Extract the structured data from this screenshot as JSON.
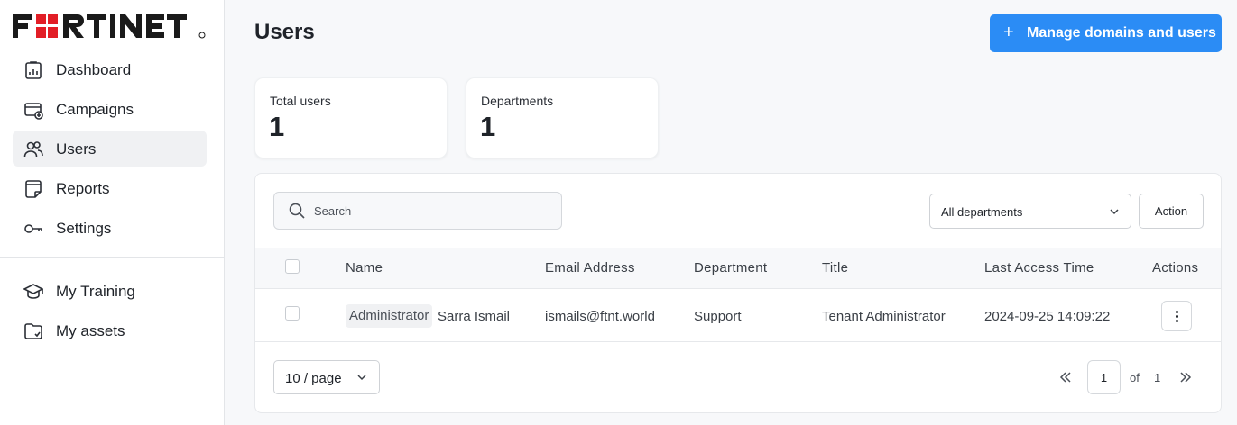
{
  "brand": {
    "name": "FORTINET",
    "accent": "#e21e26"
  },
  "sidebar": {
    "items": [
      {
        "label": "Dashboard",
        "icon": "dashboard-icon",
        "active": false
      },
      {
        "label": "Campaigns",
        "icon": "campaigns-icon",
        "active": false
      },
      {
        "label": "Users",
        "icon": "users-icon",
        "active": true
      },
      {
        "label": "Reports",
        "icon": "reports-icon",
        "active": false
      },
      {
        "label": "Settings",
        "icon": "key-icon",
        "active": false
      }
    ],
    "secondary_items": [
      {
        "label": "My Training",
        "icon": "graduation-cap-icon"
      },
      {
        "label": "My assets",
        "icon": "folder-icon"
      }
    ]
  },
  "header": {
    "title": "Users",
    "primary_button": {
      "icon": "plus-icon",
      "label": "Manage domains and users",
      "color": "#2b8cf5"
    }
  },
  "stats": [
    {
      "label": "Total users",
      "value": "1"
    },
    {
      "label": "Departments",
      "value": "1"
    }
  ],
  "toolbar": {
    "search_placeholder": "Search",
    "search_value": "",
    "department_select": "All departments",
    "action_label": "Action"
  },
  "table": {
    "columns": [
      "Name",
      "Email Address",
      "Department",
      "Title",
      "Last Access Time",
      "Actions"
    ],
    "rows": [
      {
        "role_tag": "Administrator",
        "name": "Sarra Ismail",
        "email": "ismails@ftnt.world",
        "department": "Support",
        "title": "Tenant Administrator",
        "last_access": "2024-09-25 14:09:22"
      }
    ]
  },
  "pagination": {
    "page_size": "10 / page",
    "current_page": "1",
    "of_label": "of",
    "total_pages": "1"
  }
}
